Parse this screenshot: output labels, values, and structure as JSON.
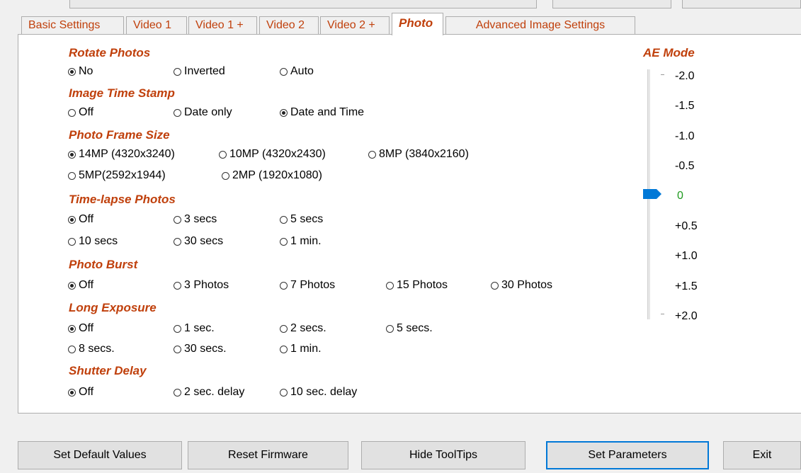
{
  "tabs": [
    {
      "label": "Basic Settings"
    },
    {
      "label": "Video 1"
    },
    {
      "label": "Video 1 +"
    },
    {
      "label": "Video 2"
    },
    {
      "label": "Video 2 +"
    },
    {
      "label": "Photo"
    },
    {
      "label": "Advanced Image Settings"
    }
  ],
  "sections": {
    "rotate": {
      "title": "Rotate Photos",
      "options": [
        "No",
        "Inverted",
        "Auto"
      ],
      "selected": "No"
    },
    "timestamp": {
      "title": "Image Time Stamp",
      "options": [
        "Off",
        "Date only",
        "Date and Time"
      ],
      "selected": "Date and Time"
    },
    "frame": {
      "title": "Photo Frame Size",
      "options": [
        "14MP (4320x3240)",
        "10MP (4320x2430)",
        "8MP (3840x2160)",
        "5MP(2592x1944)",
        "2MP (1920x1080)"
      ],
      "selected": "14MP (4320x3240)"
    },
    "timelapse": {
      "title": "Time-lapse Photos",
      "options": [
        "Off",
        "3 secs",
        "5 secs",
        "10 secs",
        "30 secs",
        "1 min."
      ],
      "selected": "Off"
    },
    "burst": {
      "title": "Photo Burst",
      "options": [
        "Off",
        "3 Photos",
        "7 Photos",
        "15 Photos",
        "30 Photos"
      ],
      "selected": "Off"
    },
    "exposure": {
      "title": "Long Exposure",
      "options": [
        "Off",
        "1 sec.",
        "2 secs.",
        "5 secs.",
        "8 secs.",
        "30 secs.",
        "1 min."
      ],
      "selected": "Off"
    },
    "shutter": {
      "title": "Shutter Delay",
      "options": [
        "Off",
        "2 sec. delay",
        "10 sec. delay"
      ],
      "selected": "Off"
    }
  },
  "ae_mode": {
    "title": "AE Mode",
    "labels": [
      "-2.0",
      "-1.5",
      "-1.0",
      "-0.5",
      "0",
      "+0.5",
      "+1.0",
      "+1.5",
      "+2.0"
    ],
    "value": "0",
    "value_color": "#1f9a1f",
    "thumb_color": "#0078d7"
  },
  "buttons": {
    "set_default": "Set Default Values",
    "reset_firmware": "Reset Firmware",
    "hide_tooltips": "Hide ToolTips",
    "set_parameters": "Set Parameters",
    "exit": "Exit"
  },
  "accent_color": "#c0400c"
}
